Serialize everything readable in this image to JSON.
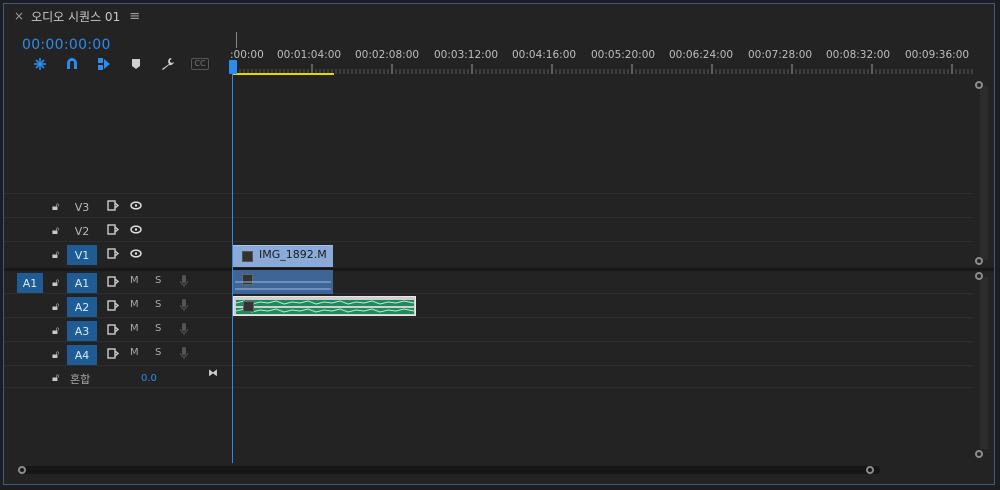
{
  "tab": {
    "close_glyph": "×",
    "title": "오디오 시퀀스 01",
    "menu_glyph": "≡"
  },
  "timecode": "00:00:00:00",
  "toolbar": {
    "icons": [
      "snap-nest-icon",
      "magnet-icon",
      "linked-selection-icon",
      "marker-icon",
      "wrench-icon",
      "captions-icon"
    ],
    "captions_label": "CC"
  },
  "ruler": {
    "labels": [
      ":00:00",
      "00:01:04:00",
      "00:02:08:00",
      "00:03:12:00",
      "00:04:16:00",
      "00:05:20:00",
      "00:06:24:00",
      "00:07:28:00",
      "00:08:32:00",
      "00:09:36:00"
    ]
  },
  "tracks": {
    "video": [
      {
        "name": "V3",
        "targeted": false
      },
      {
        "name": "V2",
        "targeted": false
      },
      {
        "name": "V1",
        "targeted": true
      }
    ],
    "audio": [
      {
        "source": "A1",
        "name": "A1",
        "m": "M",
        "s": "S"
      },
      {
        "name": "A2",
        "m": "M",
        "s": "S"
      },
      {
        "name": "A3",
        "m": "M",
        "s": "S"
      },
      {
        "name": "A4",
        "m": "M",
        "s": "S"
      }
    ],
    "mix": {
      "label": "혼합",
      "value": "0.0"
    }
  },
  "clips": {
    "v1": {
      "name": "IMG_1892.M",
      "color": "#8aabd9"
    },
    "a1": {
      "color": "#3f6597"
    },
    "a2": {
      "color": "#1f8a5a"
    }
  },
  "colors": {
    "accent": "#2d8ceb",
    "work_area": "#e6d700",
    "target": "#1f5c95"
  }
}
